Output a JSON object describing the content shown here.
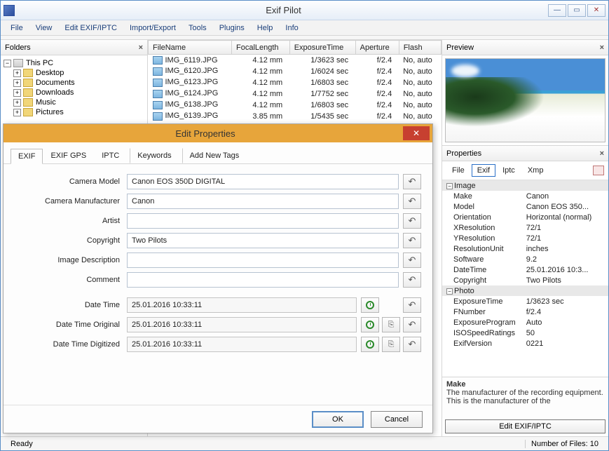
{
  "app": {
    "title": "Exif Pilot"
  },
  "menu": [
    "File",
    "View",
    "Edit EXIF/IPTC",
    "Import/Export",
    "Tools",
    "Plugins",
    "Help",
    "Info"
  ],
  "folders": {
    "title": "Folders",
    "root": "This PC",
    "items": [
      "Desktop",
      "Documents",
      "Downloads",
      "Music",
      "Pictures"
    ]
  },
  "files": {
    "columns": [
      "FileName",
      "FocalLength",
      "ExposureTime",
      "Aperture",
      "Flash"
    ],
    "rows": [
      {
        "name": "IMG_6119.JPG",
        "focal": "4.12 mm",
        "exp": "1/3623 sec",
        "apert": "f/2.4",
        "flash": "No, auto"
      },
      {
        "name": "IMG_6120.JPG",
        "focal": "4.12 mm",
        "exp": "1/6024 sec",
        "apert": "f/2.4",
        "flash": "No, auto"
      },
      {
        "name": "IMG_6123.JPG",
        "focal": "4.12 mm",
        "exp": "1/6803 sec",
        "apert": "f/2.4",
        "flash": "No, auto"
      },
      {
        "name": "IMG_6124.JPG",
        "focal": "4.12 mm",
        "exp": "1/7752 sec",
        "apert": "f/2.4",
        "flash": "No, auto"
      },
      {
        "name": "IMG_6138.JPG",
        "focal": "4.12 mm",
        "exp": "1/6803 sec",
        "apert": "f/2.4",
        "flash": "No, auto"
      },
      {
        "name": "IMG_6139.JPG",
        "focal": "3.85 mm",
        "exp": "1/5435 sec",
        "apert": "f/2.4",
        "flash": "No, auto"
      }
    ]
  },
  "preview": {
    "title": "Preview"
  },
  "properties": {
    "title": "Properties",
    "tabs": [
      "File",
      "Exif",
      "Iptc",
      "Xmp"
    ],
    "active_tab": "Exif",
    "groups": [
      {
        "name": "Image",
        "rows": [
          {
            "k": "Make",
            "v": "Canon"
          },
          {
            "k": "Model",
            "v": "Canon EOS 350..."
          },
          {
            "k": "Orientation",
            "v": "Horizontal (normal)"
          },
          {
            "k": "XResolution",
            "v": "72/1"
          },
          {
            "k": "YResolution",
            "v": "72/1"
          },
          {
            "k": "ResolutionUnit",
            "v": "inches"
          },
          {
            "k": "Software",
            "v": "9.2"
          },
          {
            "k": "DateTime",
            "v": "25.01.2016 10:3..."
          },
          {
            "k": "Copyright",
            "v": "Two Pilots"
          }
        ]
      },
      {
        "name": "Photo",
        "rows": [
          {
            "k": "ExposureTime",
            "v": "1/3623 sec"
          },
          {
            "k": "FNumber",
            "v": "f/2.4"
          },
          {
            "k": "ExposureProgram",
            "v": "Auto"
          },
          {
            "k": "ISOSpeedRatings",
            "v": "50"
          },
          {
            "k": "ExifVersion",
            "v": "0221"
          }
        ]
      }
    ],
    "info": {
      "key": "Make",
      "desc": "The manufacturer of the recording equipment. This is the manufacturer of the"
    },
    "edit_button": "Edit EXIF/IPTC"
  },
  "dialog": {
    "title": "Edit Properties",
    "tabs": [
      "EXIF",
      "EXIF GPS",
      "IPTC",
      "Keywords",
      "Add New Tags"
    ],
    "active_tab": "EXIF",
    "fields": {
      "camera_model": {
        "label": "Camera Model",
        "value": "Canon EOS 350D DIGITAL"
      },
      "camera_manufacturer": {
        "label": "Camera Manufacturer",
        "value": "Canon"
      },
      "artist": {
        "label": "Artist",
        "value": ""
      },
      "copyright": {
        "label": "Copyright",
        "value": "Two Pilots"
      },
      "image_description": {
        "label": "Image Description",
        "value": ""
      },
      "comment": {
        "label": "Comment",
        "value": ""
      },
      "date_time": {
        "label": "Date Time",
        "value": "25.01.2016 10:33:11"
      },
      "date_time_original": {
        "label": "Date Time Original",
        "value": "25.01.2016 10:33:11"
      },
      "date_time_digitized": {
        "label": "Date Time Digitized",
        "value": "25.01.2016 10:33:11"
      }
    },
    "buttons": {
      "ok": "OK",
      "cancel": "Cancel"
    }
  },
  "status": {
    "left": "Ready",
    "right": "Number of Files: 10"
  }
}
